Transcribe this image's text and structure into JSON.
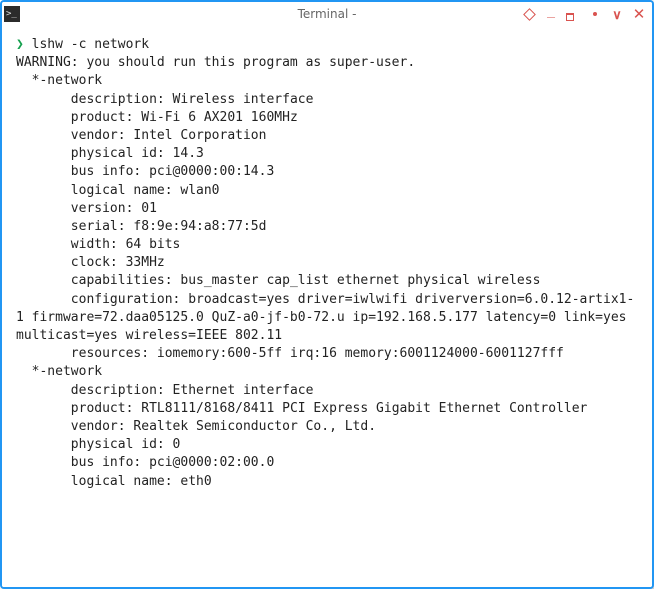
{
  "window": {
    "title": "Terminal -",
    "icon_glyph": ">_"
  },
  "controls": {
    "ontop": "diamond",
    "minimize": "_",
    "maximize": "max",
    "dot": "·",
    "v": "∨",
    "close": "✕"
  },
  "prompt": {
    "symbol": "❯",
    "command": "lshw -c network"
  },
  "output": "WARNING: you should run this program as super-user.\n  *-network\n       description: Wireless interface\n       product: Wi-Fi 6 AX201 160MHz\n       vendor: Intel Corporation\n       physical id: 14.3\n       bus info: pci@0000:00:14.3\n       logical name: wlan0\n       version: 01\n       serial: f8:9e:94:a8:77:5d\n       width: 64 bits\n       clock: 33MHz\n       capabilities: bus_master cap_list ethernet physical wireless\n       configuration: broadcast=yes driver=iwlwifi driverversion=6.0.12-artix1-1 firmware=72.daa05125.0 QuZ-a0-jf-b0-72.u ip=192.168.5.177 latency=0 link=yes multicast=yes wireless=IEEE 802.11\n       resources: iomemory:600-5ff irq:16 memory:6001124000-6001127fff\n  *-network\n       description: Ethernet interface\n       product: RTL8111/8168/8411 PCI Express Gigabit Ethernet Controller\n       vendor: Realtek Semiconductor Co., Ltd.\n       physical id: 0\n       bus info: pci@0000:02:00.0\n       logical name: eth0"
}
